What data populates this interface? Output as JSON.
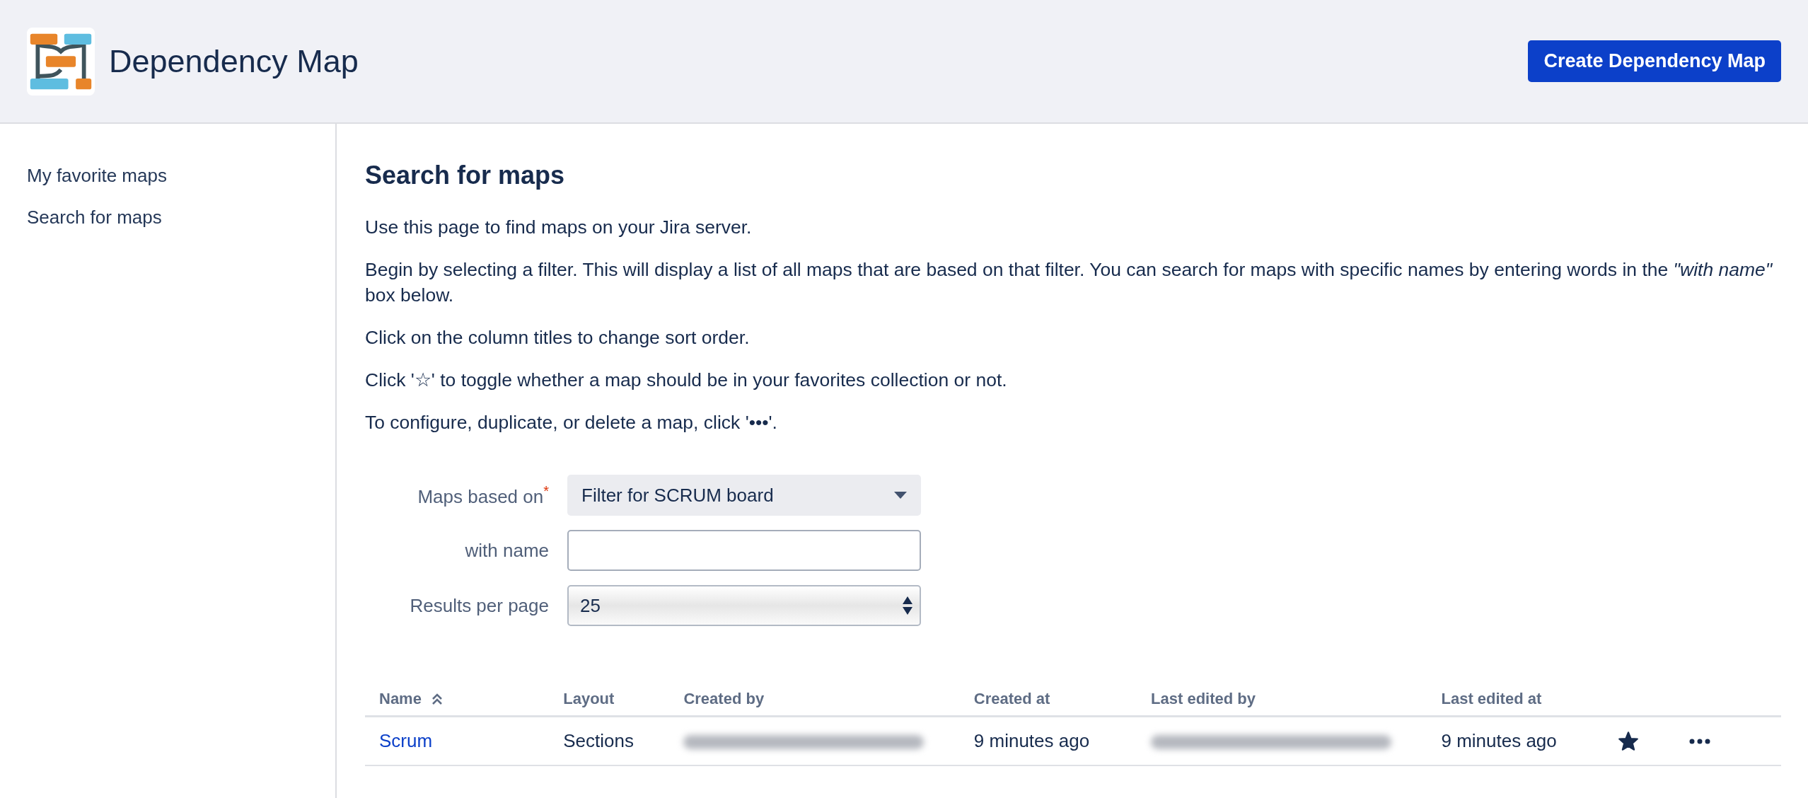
{
  "header": {
    "title": "Dependency Map",
    "action": "Create Dependency Map"
  },
  "sidebar": {
    "items": [
      {
        "label": "My favorite maps",
        "selected": false
      },
      {
        "label": "Search for maps",
        "selected": false
      }
    ]
  },
  "page": {
    "title": "Search for maps",
    "paragraphs": [
      "Use this page to find maps on your Jira server.",
      "Begin by selecting a filter. This will display a list of all maps that are based on that filter. You can search for maps with specific names by entering words in the *\"with name\"* box below.",
      "Click on the column titles to change sort order.",
      "Click '☆' to toggle whether a map should be in your favorites collection or not.",
      "To configure, duplicate, or delete a map, click '•••'."
    ]
  },
  "form": {
    "fields": [
      {
        "kind": "dropdown",
        "label": "Maps based on",
        "required_mark": "*",
        "value": "Filter for SCRUM board"
      },
      {
        "kind": "text",
        "label": "with name"
      },
      {
        "kind": "select",
        "label": "Results per page",
        "value": "25"
      }
    ]
  },
  "table": {
    "columns": [
      {
        "label": "Name",
        "sorted": true
      },
      {
        "label": "Layout",
        "sorted": false
      },
      {
        "label": "Created by",
        "sorted": false
      },
      {
        "label": "Created at",
        "sorted": false
      },
      {
        "label": "Last edited by",
        "sorted": false
      },
      {
        "label": "Last edited at",
        "sorted": false
      }
    ],
    "rows": [
      {
        "name": "Scrum",
        "layout": "Sections",
        "created_by": {
          "redacted": true
        },
        "created_at": "9 minutes ago",
        "last_edited_by": {
          "redacted": true
        },
        "last_edited_at": "9 minutes ago",
        "favorite": true
      }
    ]
  }
}
